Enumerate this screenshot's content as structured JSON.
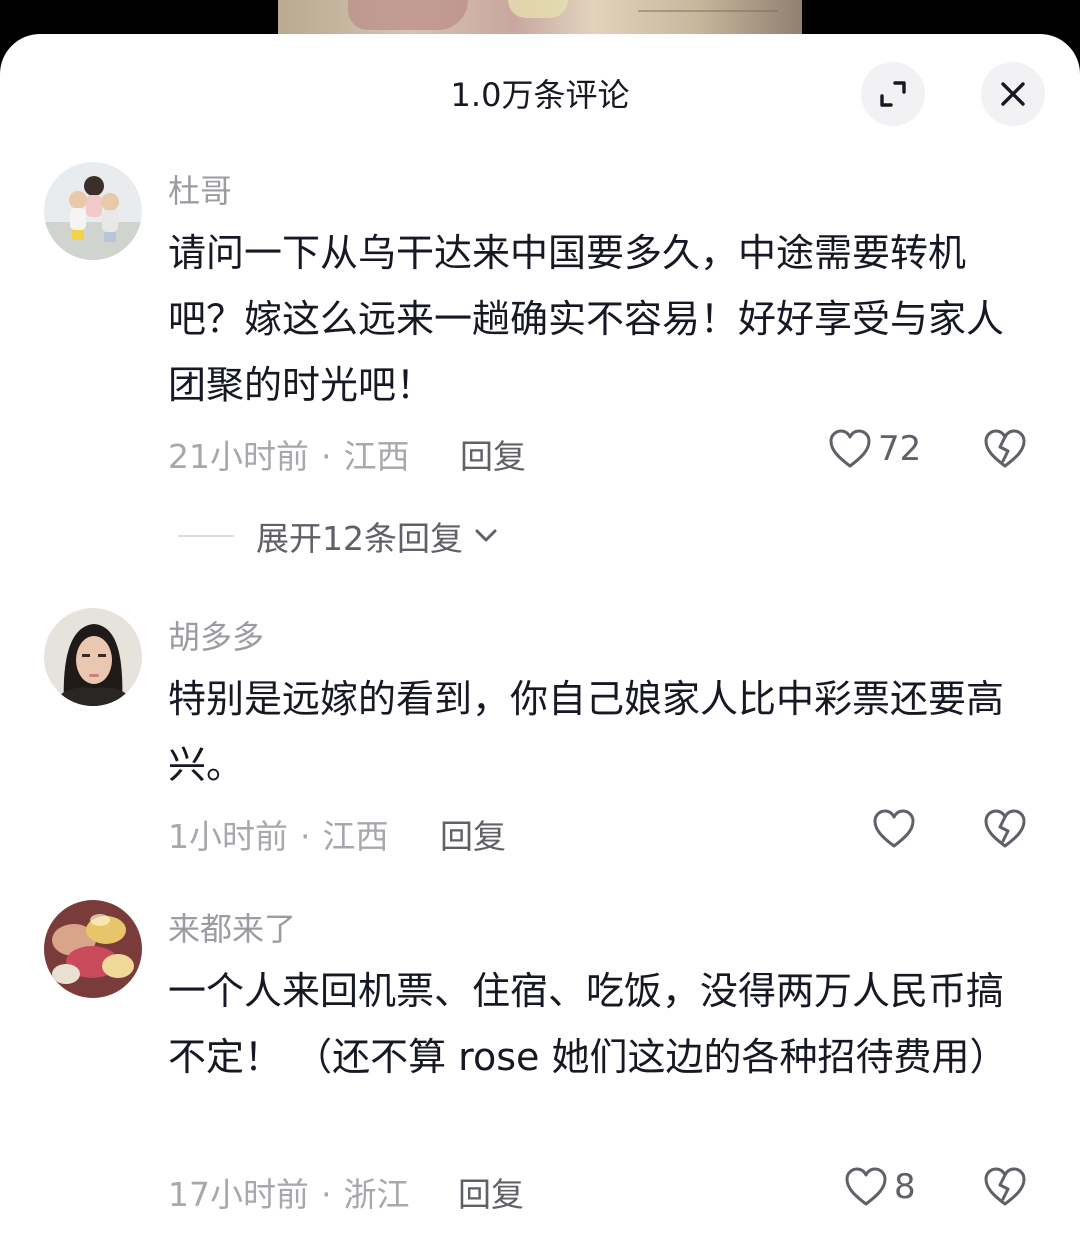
{
  "header": {
    "title": "1.0万条评论"
  },
  "comments": [
    {
      "username": "杜哥",
      "text": "请问一下从乌干达来中国要多久，中途需要转机吧？嫁这么远来一趟确实不容易！好好享受与家人团聚的时光吧！",
      "time": "21小时前",
      "location": "江西",
      "reply_label": "回复",
      "likes": "72",
      "expand_replies": "展开12条回复"
    },
    {
      "username": "胡多多",
      "text": "特别是远嫁的看到，你自己娘家人比中彩票还要高兴。",
      "time": "1小时前",
      "location": "江西",
      "reply_label": "回复",
      "likes": ""
    },
    {
      "username": "来都来了",
      "text": "一个人来回机票、住宿、吃饭，没得两万人民币搞不定！ （还不算 rose 她们这边的各种招待费用）",
      "time": "17小时前",
      "location": "浙江",
      "reply_label": "回复",
      "likes": "8"
    }
  ],
  "icons": {
    "expand": "expand-arrows-icon",
    "close": "close-icon",
    "like": "heart-outline-icon",
    "dislike": "broken-heart-icon",
    "chevron": "chevron-down-icon"
  },
  "colors": {
    "primary_text": "#161823",
    "secondary_text": "#9b9ca1",
    "action_text": "#5f6068",
    "button_bg": "#f2f2f4"
  }
}
